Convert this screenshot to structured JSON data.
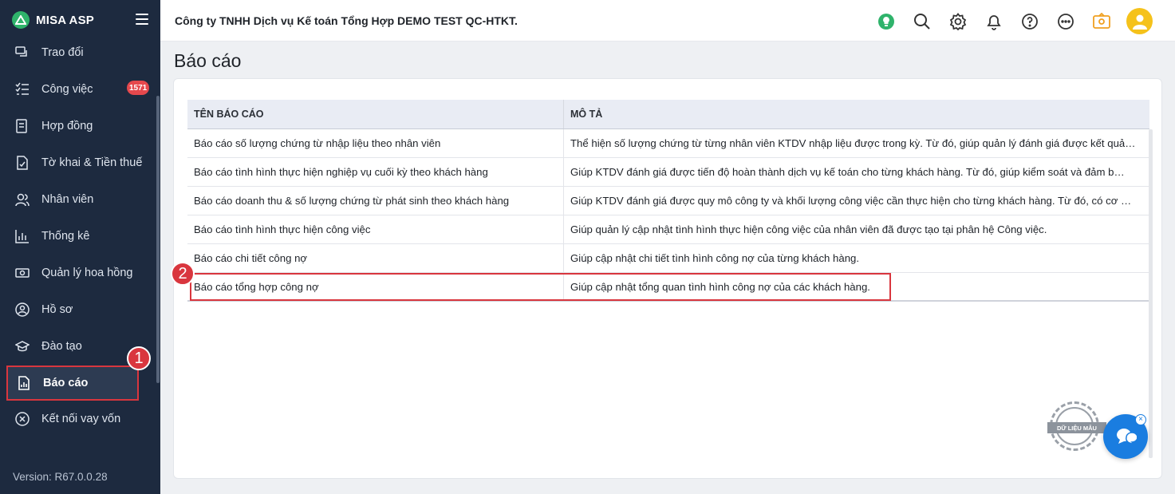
{
  "app": {
    "name": "MISA ASP"
  },
  "sidebar": {
    "items": [
      {
        "label": "Trao đổi",
        "icon": "exchange-icon"
      },
      {
        "label": "Công việc",
        "icon": "task-list-icon",
        "badge": "1571"
      },
      {
        "label": "Hợp đồng",
        "icon": "contract-icon"
      },
      {
        "label": "Tờ khai & Tiền thuế",
        "icon": "tax-declaration-icon"
      },
      {
        "label": "Nhân viên",
        "icon": "employees-icon"
      },
      {
        "label": "Thống kê",
        "icon": "statistics-icon"
      },
      {
        "label": "Quản lý hoa hồng",
        "icon": "commission-icon"
      },
      {
        "label": "Hồ sơ",
        "icon": "profile-icon"
      },
      {
        "label": "Đào tạo",
        "icon": "training-icon"
      },
      {
        "label": "Báo cáo",
        "icon": "report-icon",
        "active": true
      },
      {
        "label": "Kết nối vay vốn",
        "icon": "loan-connect-icon"
      }
    ],
    "version": "Version: R67.0.0.28"
  },
  "header": {
    "company": "Công ty TNHH Dịch vụ Kế toán Tổng Hợp DEMO TEST QC-HTKT.",
    "icons": [
      "lightbulb-icon",
      "search-icon",
      "settings-icon",
      "bell-icon",
      "help-icon",
      "more-icon",
      "rewards-icon",
      "user-avatar"
    ]
  },
  "page": {
    "title": "Báo cáo"
  },
  "table": {
    "columns": [
      "TÊN BÁO CÁO",
      "MÔ TẢ"
    ],
    "rows": [
      {
        "name": "Báo cáo số lượng chứng từ nhập liệu theo nhân viên",
        "desc": "Thể hiện số lượng chứng từ từng nhân viên KTDV nhập liệu được trong kỳ. Từ đó, giúp quản lý đánh giá được kết quả…"
      },
      {
        "name": "Báo cáo tình hình thực hiện nghiệp vụ cuối kỳ theo khách hàng",
        "desc": "Giúp KTDV đánh giá được tiến độ hoàn thành dịch vụ kế toán cho từng khách hàng. Từ đó, giúp kiểm soát và đảm b…"
      },
      {
        "name": "Báo cáo doanh thu & số lượng chứng từ phát sinh theo khách hàng",
        "desc": "Giúp KTDV đánh giá được quy mô công ty và khối lượng công việc cần thực hiện cho từng khách hàng. Từ đó, có cơ …"
      },
      {
        "name": "Báo cáo tình hình thực hiện công việc",
        "desc": "Giúp quản lý cập nhật tình hình thực hiện công việc của nhân viên đã được tạo tại phân hệ Công việc."
      },
      {
        "name": "Báo cáo chi tiết công nợ",
        "desc": "Giúp cập nhật chi tiết tình hình công nợ của từng khách hàng."
      },
      {
        "name": "Báo cáo tổng hợp công nợ",
        "desc": "Giúp cập nhật tổng quan tình hình công nợ của các khách hàng."
      }
    ]
  },
  "annotations": {
    "step1": "1",
    "step2": "2"
  },
  "floating": {
    "sample_stamp": "DỮ LIỆU MẪU",
    "chat_close": "×"
  },
  "colors": {
    "sidebar_bg": "#1d2a3f",
    "accent_green": "#2fb36b",
    "highlight_red": "#d9363e",
    "chat_blue": "#1a7de0",
    "header_bg": "#e9ecf4"
  }
}
